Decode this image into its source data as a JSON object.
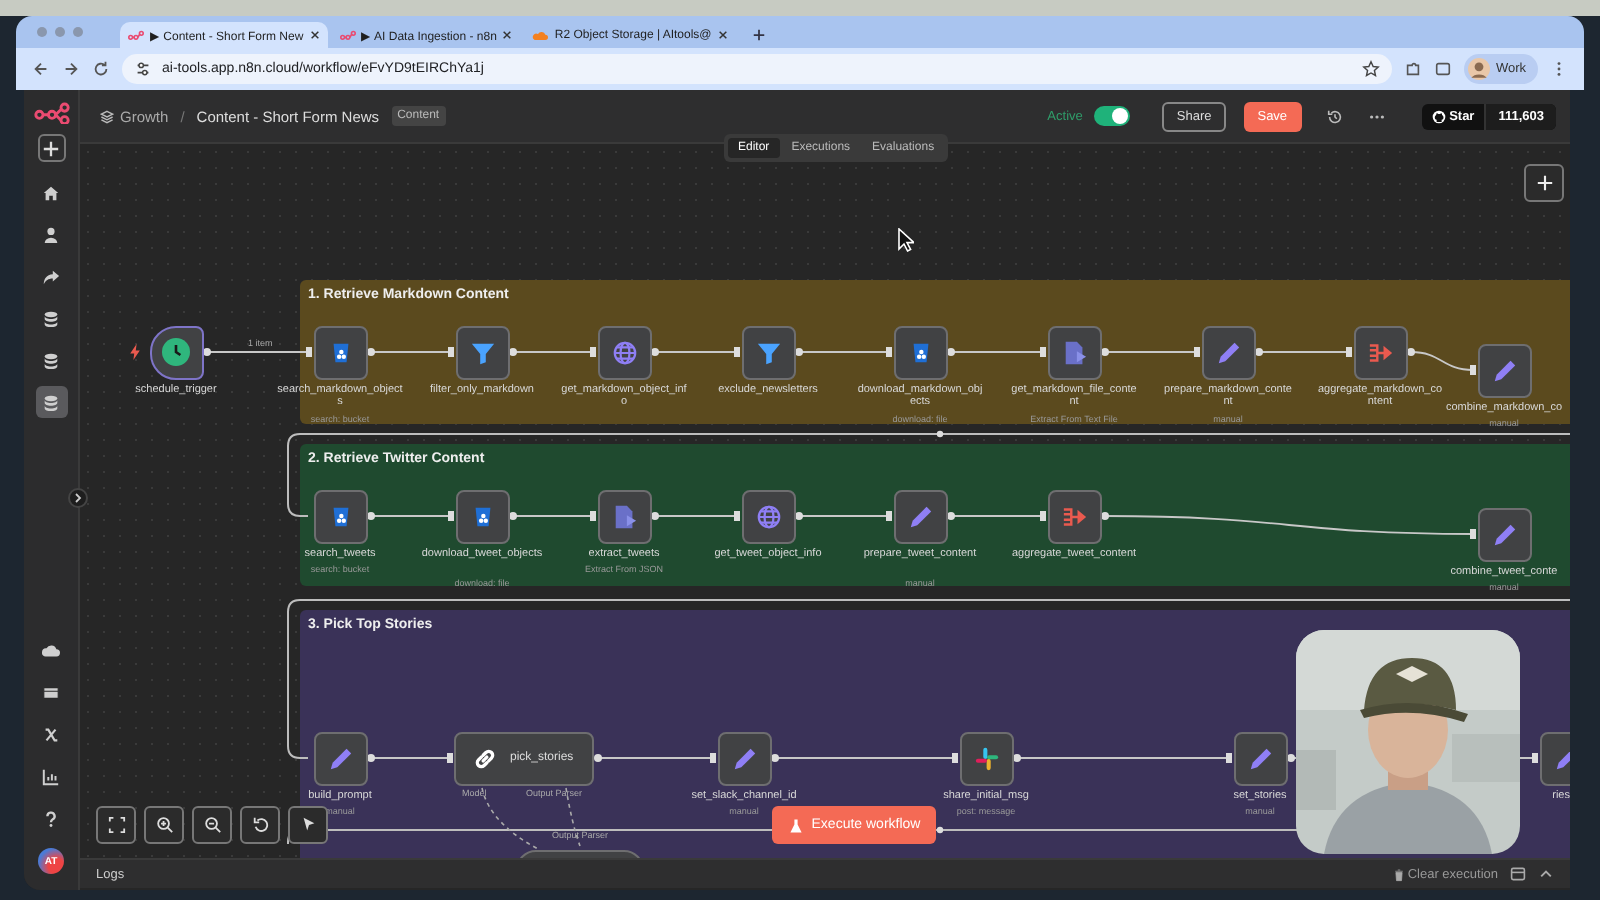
{
  "browser": {
    "tabs": [
      {
        "title": "▶ Content - Short Form New",
        "selected": true
      },
      {
        "title": "▶ AI Data Ingestion - n8n",
        "selected": false
      },
      {
        "title": "R2 Object Storage | AItools@",
        "selected": false
      }
    ],
    "url": "ai-tools.app.n8n.cloud/workflow/eFvYD9tEIRChYa1j",
    "profile": "Work"
  },
  "sidebar": {
    "items": [
      {
        "kind": "home",
        "selected": false
      },
      {
        "kind": "user",
        "selected": false
      },
      {
        "kind": "share",
        "selected": false
      },
      {
        "kind": "database",
        "selected": false
      },
      {
        "kind": "database",
        "selected": false
      },
      {
        "kind": "database",
        "selected": true
      }
    ],
    "bottom_items": [
      {
        "kind": "cloud"
      },
      {
        "kind": "template"
      },
      {
        "kind": "variable"
      },
      {
        "kind": "chart"
      },
      {
        "kind": "help"
      }
    ],
    "avatar": "AT"
  },
  "header": {
    "project": "Growth",
    "separator": "/",
    "workflow": "Content - Short Form News",
    "tag": "Content",
    "active_label": "Active",
    "active": true,
    "share": "Share",
    "save": "Save",
    "star": "Star",
    "star_count": "111,603"
  },
  "view_tabs": [
    {
      "label": "Editor",
      "selected": true
    },
    {
      "label": "Executions",
      "selected": false
    },
    {
      "label": "Evaluations",
      "selected": false
    }
  ],
  "canvas": {
    "trigger": {
      "label": "schedule_trigger"
    },
    "edge_label": "1 item",
    "groups": [
      {
        "title": "1. Retrieve Markdown Content",
        "color": "#5b4a1e",
        "nodes": [
          {
            "kind": "bucket",
            "label": "search_markdown_objects",
            "sub": "search: bucket"
          },
          {
            "kind": "filter",
            "label": "filter_only_markdown"
          },
          {
            "kind": "globe",
            "label": "get_markdown_object_info"
          },
          {
            "kind": "filter",
            "label": "exclude_newsletters"
          },
          {
            "kind": "bucket",
            "label": "download_markdown_objects",
            "sub": "download: file"
          },
          {
            "kind": "file",
            "label": "get_markdown_file_content",
            "sub": "Extract From Text File"
          },
          {
            "kind": "pencil",
            "label": "prepare_markdown_content",
            "sub": "manual"
          },
          {
            "kind": "aggregate",
            "label": "aggregate_markdown_content"
          },
          {
            "kind": "pencil",
            "label": "combine_markdown_co",
            "sub": "manual"
          }
        ]
      },
      {
        "title": "2. Retrieve Twitter Content",
        "color": "#1f4a2f",
        "nodes": [
          {
            "kind": "bucket",
            "label": "search_tweets",
            "sub": "search: bucket"
          },
          {
            "kind": "bucket",
            "label": "download_tweet_objects",
            "sub": "download: file"
          },
          {
            "kind": "file",
            "label": "extract_tweets",
            "sub": "Extract From JSON"
          },
          {
            "kind": "globe",
            "label": "get_tweet_object_info"
          },
          {
            "kind": "pencil",
            "label": "prepare_tweet_content",
            "sub": "manual"
          },
          {
            "kind": "aggregate",
            "label": "aggregate_tweet_content"
          },
          {
            "kind": "pencil",
            "label": "combine_tweet_conte",
            "sub": "manual"
          }
        ]
      },
      {
        "title": "3. Pick Top Stories",
        "color": "#3a3258",
        "nodes": [
          {
            "kind": "pencil",
            "label": "build_prompt",
            "sub": "manual"
          },
          {
            "kind": "agent",
            "label": "pick_stories",
            "handles": [
              "Model",
              "Output Parser"
            ]
          },
          {
            "kind": "pencil",
            "label": "set_slack_channel_id",
            "sub": "manual"
          },
          {
            "kind": "slack",
            "label": "share_initial_msg",
            "sub": "post: message"
          },
          {
            "kind": "pencil",
            "label": "set_stories",
            "sub": "manual"
          },
          {
            "kind": "pencil",
            "label": "ries"
          },
          {
            "kind": "stub",
            "label": "Output Parser"
          }
        ]
      }
    ],
    "execute_button": "Execute workflow"
  },
  "logs": {
    "label": "Logs",
    "clear": "Clear execution"
  }
}
